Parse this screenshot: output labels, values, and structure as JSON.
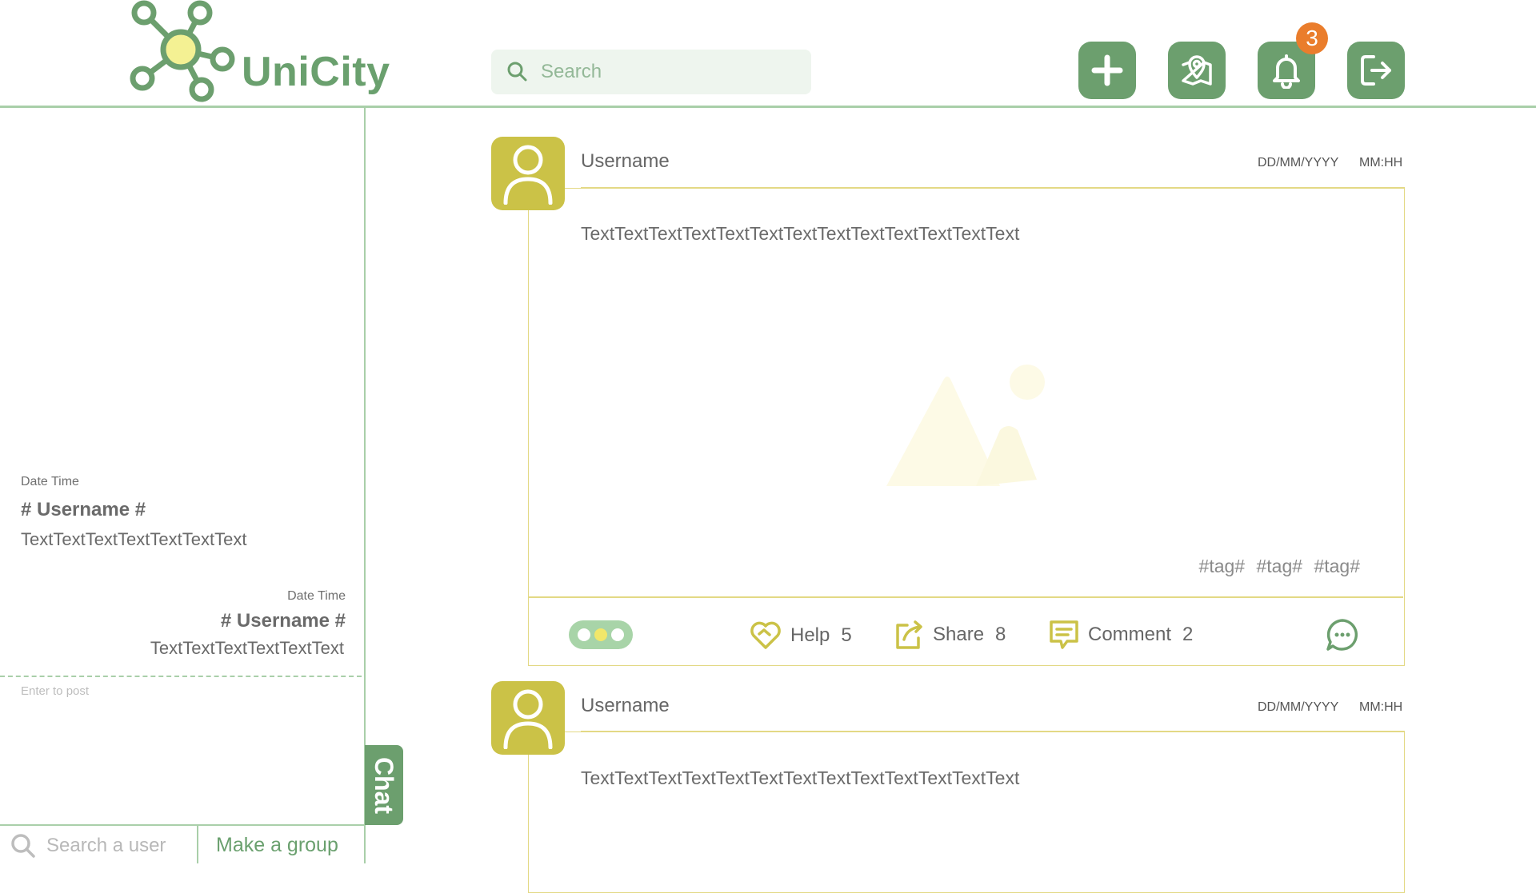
{
  "app": {
    "name": "UniCity"
  },
  "header": {
    "search_placeholder": "Search",
    "notification_count": "3",
    "buttons": [
      "add-icon",
      "map-pin-icon",
      "bell-icon",
      "logout-icon"
    ]
  },
  "sidebar": {
    "messages": [
      {
        "datetime": "Date Time",
        "username": "# Username #",
        "text": "TextTextTextTextTextTextText",
        "align": "left"
      },
      {
        "datetime": "Date Time",
        "username": "# Username #",
        "text": "TextTextTextTextTextText",
        "align": "right"
      }
    ],
    "compose_placeholder": "Enter to post",
    "search_user_placeholder": "Search a user",
    "make_group_label": "Make a group",
    "chat_tab_label": "Chat"
  },
  "posts": [
    {
      "username": "Username",
      "date": "DD/MM/YYYY",
      "time": "MM:HH",
      "text": "TextTextTextTextTextTextTextTextTextTextTextTextText",
      "tags": "#tag#  #tag#  #tag#",
      "help_label": "Help",
      "help_count": "5",
      "share_label": "Share",
      "share_count": "8",
      "comment_label": "Comment",
      "comment_count": "2"
    },
    {
      "username": "Username",
      "date": "DD/MM/YYYY",
      "time": "MM:HH",
      "text": "TextTextTextTextTextTextTextTextTextTextTextTextText"
    }
  ],
  "colors": {
    "brand_green": "#6c9f6e",
    "light_green": "#a9cfa9",
    "avatar_yellow": "#cbc247",
    "badge_orange": "#ea7d2c"
  }
}
